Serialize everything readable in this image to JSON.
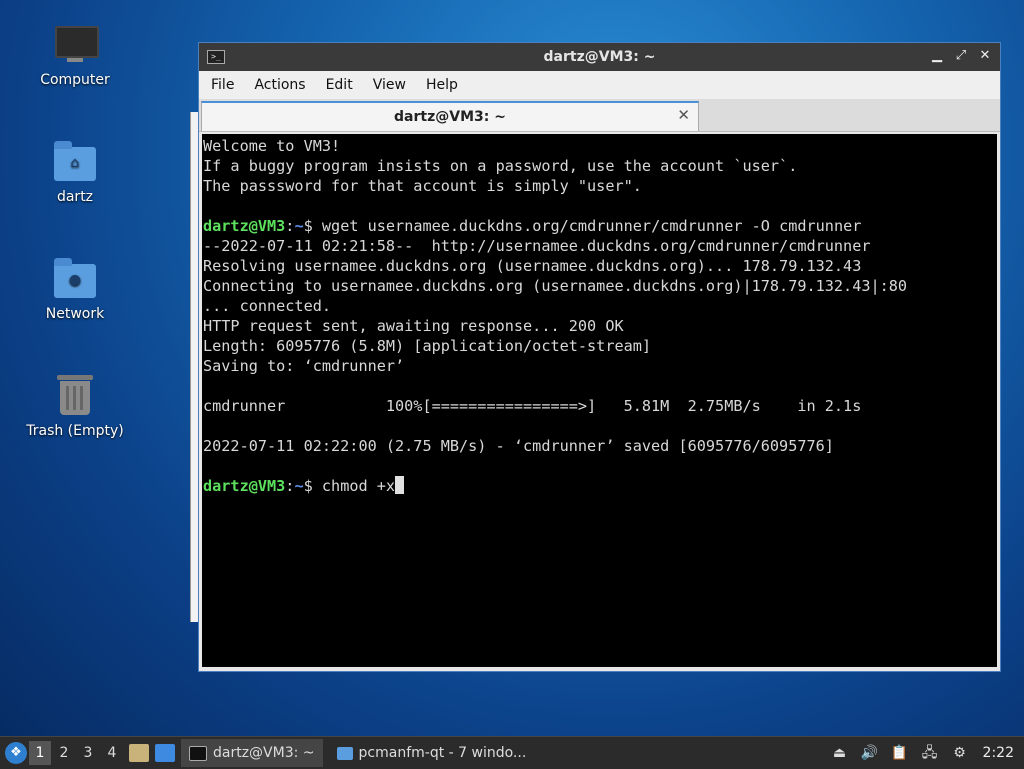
{
  "desktop": {
    "icons": [
      {
        "label": "Computer",
        "icon": "computer-icon"
      },
      {
        "label": "dartz",
        "icon": "home-folder-icon"
      },
      {
        "label": "Network",
        "icon": "network-folder-icon"
      },
      {
        "label": "Trash (Empty)",
        "icon": "trash-icon"
      }
    ]
  },
  "terminal": {
    "window_title": "dartz@VM3: ~",
    "menu": [
      "File",
      "Actions",
      "Edit",
      "View",
      "Help"
    ],
    "tab_label": "dartz@VM3: ~",
    "prompt_user": "dartz@VM3",
    "prompt_path": "~",
    "lines": [
      "Welcome to VM3!",
      "If a buggy program insists on a password, use the account `user`.",
      "The passsword for that account is simply \"user\".",
      ""
    ],
    "command1": "wget usernamee.duckdns.org/cmdrunner/cmdrunner -O cmdrunner",
    "output1": [
      "--2022-07-11 02:21:58--  http://usernamee.duckdns.org/cmdrunner/cmdrunner",
      "Resolving usernamee.duckdns.org (usernamee.duckdns.org)... 178.79.132.43",
      "Connecting to usernamee.duckdns.org (usernamee.duckdns.org)|178.79.132.43|:80",
      "... connected.",
      "HTTP request sent, awaiting response... 200 OK",
      "Length: 6095776 (5.8M) [application/octet-stream]",
      "Saving to: ‘cmdrunner’",
      "",
      "cmdrunner           100%[================>]   5.81M  2.75MB/s    in 2.1s",
      "",
      "2022-07-11 02:22:00 (2.75 MB/s) - ‘cmdrunner’ saved [6095776/6095776]",
      ""
    ],
    "command2": "chmod +x"
  },
  "taskbar": {
    "workspaces": [
      "1",
      "2",
      "3",
      "4"
    ],
    "active_workspace": "1",
    "tasks": [
      {
        "label": "dartz@VM3: ~",
        "icon": "terminal-icon"
      },
      {
        "label": "pcmanfm-qt - 7 windo...",
        "icon": "folder-icon"
      }
    ],
    "clock": "2:22"
  }
}
